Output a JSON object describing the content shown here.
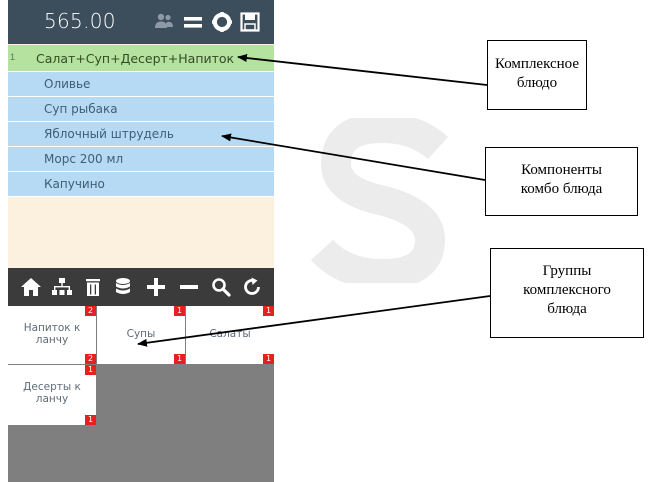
{
  "header": {
    "total": "565.00",
    "icons": [
      "users-icon",
      "menu-icon",
      "gear-icon",
      "save-icon"
    ]
  },
  "order": {
    "combo": {
      "index": "1",
      "label": "Салат+Суп+Десерт+Напиток"
    },
    "components": [
      {
        "label": "Оливье"
      },
      {
        "label": "Суп рыбака"
      },
      {
        "label": "Яблочный штрудель"
      },
      {
        "label": "Морс 200 мл"
      },
      {
        "label": "Капучино"
      }
    ]
  },
  "toolbar": {
    "icons": [
      "home-icon",
      "hierarchy-icon",
      "trash-icon",
      "database-icon",
      "plus-icon",
      "minus-icon",
      "search-icon",
      "refresh-icon"
    ]
  },
  "groups": [
    {
      "label_line1": "Напиток к",
      "label_line2": "ланчу",
      "badge_top": "2",
      "badge_bottom": "2",
      "badge_bottom2": "1"
    },
    {
      "label_line1": "Супы",
      "label_line2": "",
      "badge_top": "1",
      "badge_bottom": "1"
    },
    {
      "label_line1": "Салаты",
      "label_line2": "",
      "badge_top": "1",
      "badge_bottom": "1"
    },
    {
      "label_line1": "Десерты к",
      "label_line2": "ланчу",
      "badge_top": "1",
      "badge_bottom": "1"
    }
  ],
  "callouts": {
    "combo_dish": {
      "line1": "Комплексное",
      "line2": "блюдо"
    },
    "components": {
      "line1": "Компоненты",
      "line2": "комбо блюда"
    },
    "groups": {
      "line1": "Группы",
      "line2": "комплексного",
      "line3": "блюда"
    }
  },
  "colors": {
    "topbar": "#3c4d5c",
    "combo_row": "#b5e29f",
    "component_row": "#b6daf3",
    "order_bg": "#fcf1de",
    "toolbar": "#3b3b3b",
    "badge": "#e62020",
    "grid_bg": "#7f7f7f"
  }
}
